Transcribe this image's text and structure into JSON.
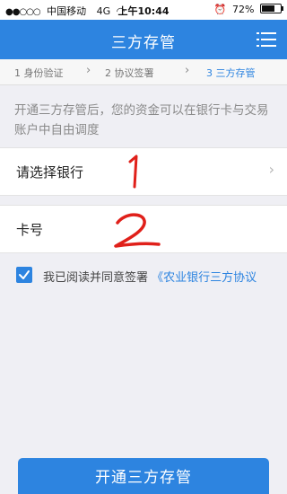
{
  "status": {
    "carrier": "中国移动",
    "network": "4G",
    "time": "上午10:44",
    "battery": "72%",
    "battery_level": 0.72
  },
  "header": {
    "title": "三方存管",
    "menu_icon": "menu-icon"
  },
  "steps": [
    {
      "label": "1 身份验证"
    },
    {
      "label": "2 协议签署"
    },
    {
      "label": "3 三方存管"
    }
  ],
  "notice": "开通三方存管后，您的资金可以在银行卡与交易账户中自由调度",
  "form": {
    "bank_label": "请选择银行",
    "card_label": "卡号",
    "card_value": ""
  },
  "annotations": {
    "one": "1",
    "two": "2"
  },
  "agreement": {
    "prefix": "我已阅读并同意签署",
    "link": "《农业银行三方协议"
  },
  "submit_label": "开通三方存管",
  "colors": {
    "accent": "#2d84e0",
    "annotation": "#e0201a"
  }
}
